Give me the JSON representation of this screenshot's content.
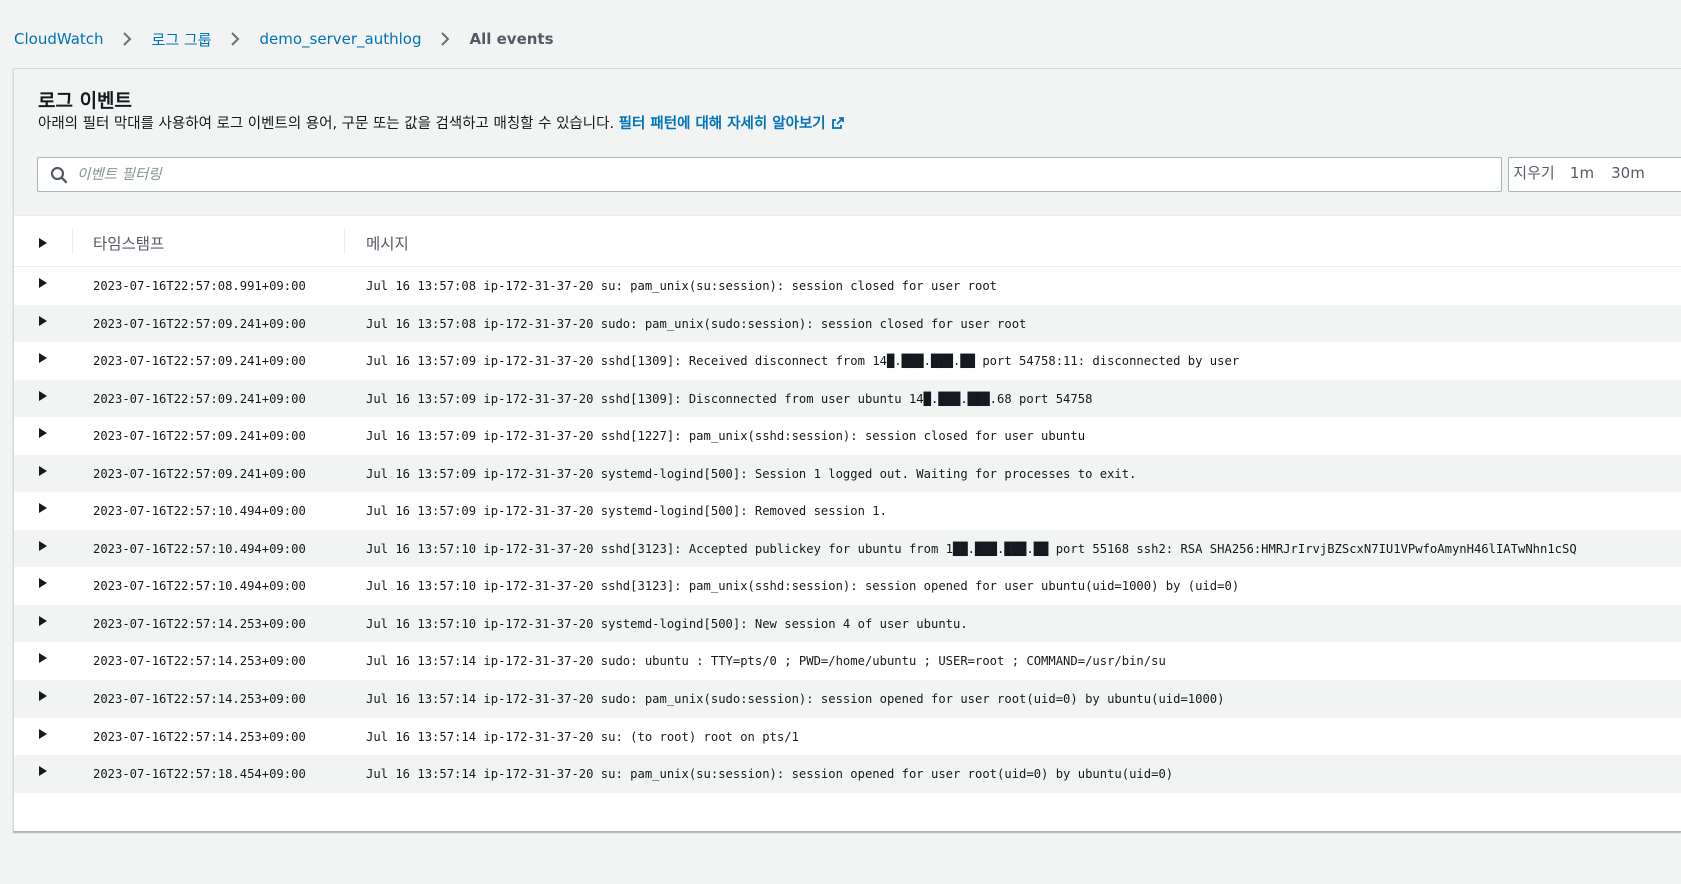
{
  "breadcrumb": {
    "items": [
      {
        "label": "CloudWatch"
      },
      {
        "label": "로그 그룹"
      },
      {
        "label": "demo_server_authlog"
      }
    ],
    "current": "All events"
  },
  "panel": {
    "title": "로그 이벤트",
    "description": "아래의 필터 막대를 사용하여 로그 이벤트의 용어, 구문 또는 값을 검색하고 매칭할 수 있습니다.",
    "learn_more_link": "필터 패턴에 대해 자세히 알아보기",
    "search_placeholder": "이벤트 필터링",
    "search_value": "",
    "range_options": [
      {
        "label": "지우기"
      },
      {
        "label": "1m"
      },
      {
        "label": "30m"
      }
    ]
  },
  "table": {
    "columns": {
      "timestamp": "타임스탬프",
      "message": "메시지"
    },
    "rows": [
      {
        "timestamp": "2023-07-16T22:57:08.991+09:00",
        "message": "Jul 16 13:57:08 ip-172-31-37-20 su: pam_unix(su:session): session closed for user root"
      },
      {
        "timestamp": "2023-07-16T22:57:09.241+09:00",
        "message": "Jul 16 13:57:08 ip-172-31-37-20 sudo: pam_unix(sudo:session): session closed for user root"
      },
      {
        "timestamp": "2023-07-16T22:57:09.241+09:00",
        "message": "Jul 16 13:57:09 ip-172-31-37-20 sshd[1309]: Received disconnect from 14█.███.███.██ port 54758:11: disconnected by user"
      },
      {
        "timestamp": "2023-07-16T22:57:09.241+09:00",
        "message": "Jul 16 13:57:09 ip-172-31-37-20 sshd[1309]: Disconnected from user ubuntu 14█.███.███.68 port 54758"
      },
      {
        "timestamp": "2023-07-16T22:57:09.241+09:00",
        "message": "Jul 16 13:57:09 ip-172-31-37-20 sshd[1227]: pam_unix(sshd:session): session closed for user ubuntu"
      },
      {
        "timestamp": "2023-07-16T22:57:09.241+09:00",
        "message": "Jul 16 13:57:09 ip-172-31-37-20 systemd-logind[500]: Session 1 logged out. Waiting for processes to exit."
      },
      {
        "timestamp": "2023-07-16T22:57:10.494+09:00",
        "message": "Jul 16 13:57:09 ip-172-31-37-20 systemd-logind[500]: Removed session 1."
      },
      {
        "timestamp": "2023-07-16T22:57:10.494+09:00",
        "message": "Jul 16 13:57:10 ip-172-31-37-20 sshd[3123]: Accepted publickey for ubuntu from 1██.███.███.██ port 55168 ssh2: RSA SHA256:HMRJrIrvjBZScxN7IU1VPwfoAmynH46lIATwNhn1cSQ"
      },
      {
        "timestamp": "2023-07-16T22:57:10.494+09:00",
        "message": "Jul 16 13:57:10 ip-172-31-37-20 sshd[3123]: pam_unix(sshd:session): session opened for user ubuntu(uid=1000) by (uid=0)"
      },
      {
        "timestamp": "2023-07-16T22:57:14.253+09:00",
        "message": "Jul 16 13:57:10 ip-172-31-37-20 systemd-logind[500]: New session 4 of user ubuntu."
      },
      {
        "timestamp": "2023-07-16T22:57:14.253+09:00",
        "message": "Jul 16 13:57:14 ip-172-31-37-20 sudo: ubuntu : TTY=pts/0 ; PWD=/home/ubuntu ; USER=root ; COMMAND=/usr/bin/su"
      },
      {
        "timestamp": "2023-07-16T22:57:14.253+09:00",
        "message": "Jul 16 13:57:14 ip-172-31-37-20 sudo: pam_unix(sudo:session): session opened for user root(uid=0) by ubuntu(uid=1000)"
      },
      {
        "timestamp": "2023-07-16T22:57:14.253+09:00",
        "message": "Jul 16 13:57:14 ip-172-31-37-20 su: (to root) root on pts/1"
      },
      {
        "timestamp": "2023-07-16T22:57:18.454+09:00",
        "message": "Jul 16 13:57:14 ip-172-31-37-20 su: pam_unix(su:session): session opened for user root(uid=0) by ubuntu(uid=0)"
      }
    ]
  },
  "colors": {
    "link": "#0073bb",
    "text": "#16191f",
    "muted": "#545b64",
    "background": "#f2f3f3",
    "row_alt": "#f2f3f3",
    "border": "#aab7b8"
  },
  "icons": {
    "breadcrumb_separator": "chevron-right-icon",
    "external_link": "external-link-icon",
    "search": "search-icon",
    "row_expand": "caret-right-icon"
  }
}
